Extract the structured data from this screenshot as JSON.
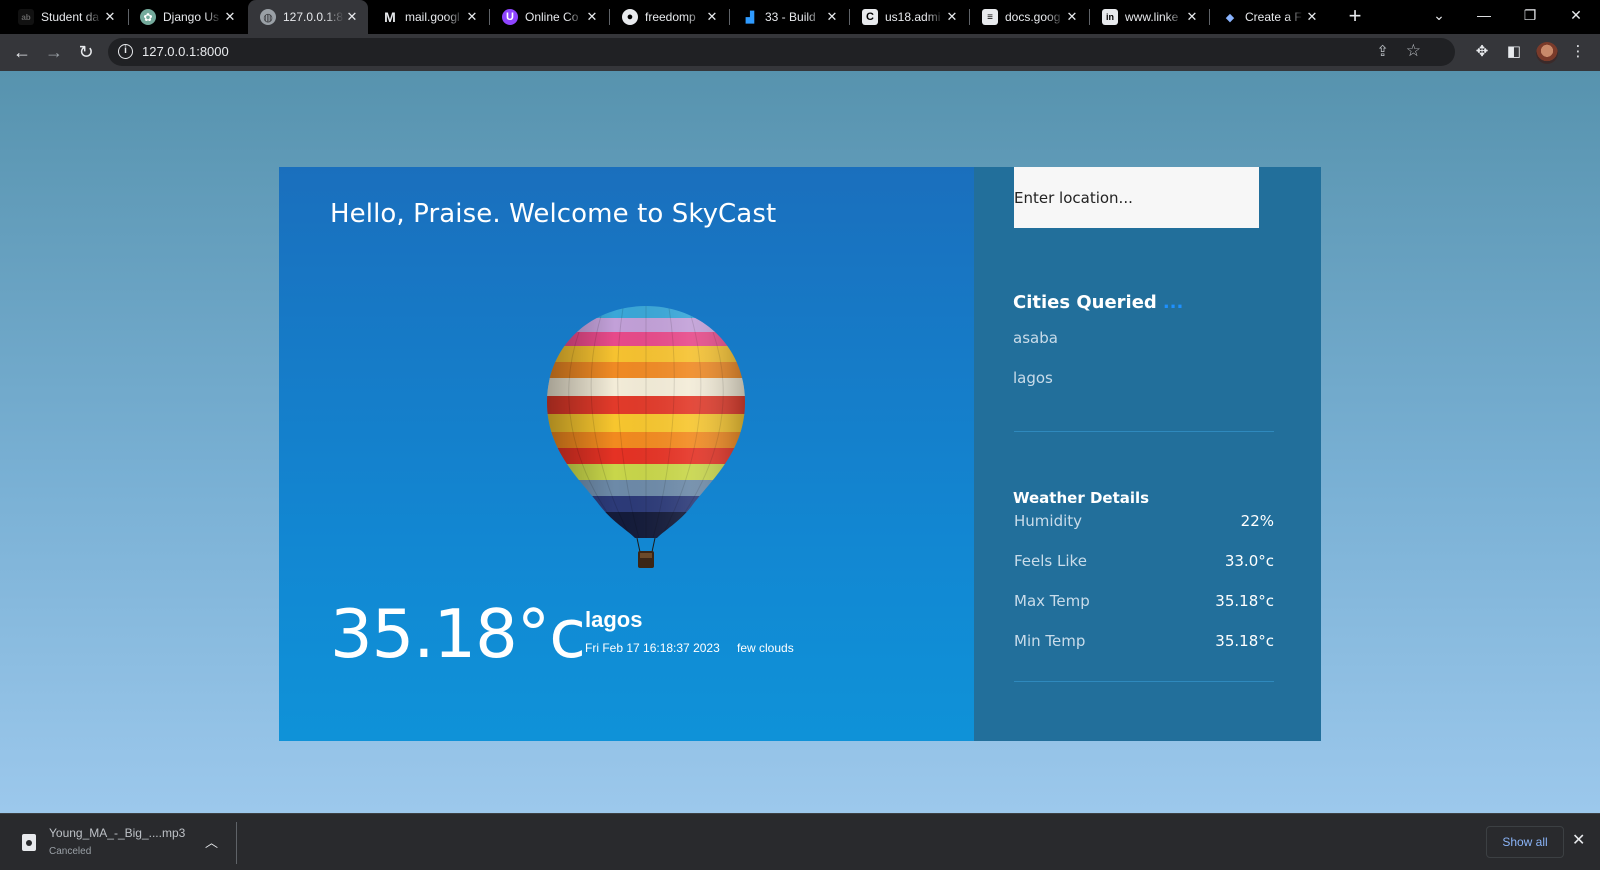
{
  "browser": {
    "tabs": [
      {
        "title": "Student da",
        "favicon": "dark-site-icon"
      },
      {
        "title": "Django Us",
        "favicon": "chatgpt-icon"
      },
      {
        "title": "127.0.0.1:8",
        "favicon": "globe-icon",
        "active": true
      },
      {
        "title": "mail.googl",
        "favicon": "gmail-icon"
      },
      {
        "title": "Online Co",
        "favicon": "purple-u-icon"
      },
      {
        "title": "freedomp",
        "favicon": "github-icon"
      },
      {
        "title": "33 - Build",
        "favicon": "azure-devops-icon"
      },
      {
        "title": "us18.admi",
        "favicon": "mailchimp-icon"
      },
      {
        "title": "docs.goog",
        "favicon": "docs-icon"
      },
      {
        "title": "www.linke",
        "favicon": "linkedin-icon"
      },
      {
        "title": "Create a F",
        "favicon": "diamond-icon"
      }
    ],
    "url": "127.0.0.1:8000"
  },
  "page": {
    "greeting": "Hello, Praise. Welcome to SkyCast",
    "temperature": "35.18°c",
    "city": "lagos",
    "datetime": "Fri Feb 17 16:18:37 2023",
    "description": "few clouds",
    "search_placeholder": "Enter location...",
    "cities_heading": "Cities Queried",
    "cities_dots": "...",
    "cities": [
      "asaba",
      "lagos"
    ],
    "details_heading": "Weather Details",
    "details": [
      {
        "label": "Humidity",
        "value": "22%"
      },
      {
        "label": "Feels Like",
        "value": "33.0°c"
      },
      {
        "label": "Max Temp",
        "value": "35.18°c"
      },
      {
        "label": "Min Temp",
        "value": "35.18°c"
      }
    ]
  },
  "downloads": {
    "file_name": "Young_MA_-_Big_....mp3",
    "status": "Canceled",
    "show_all_label": "Show all"
  },
  "colors": {
    "main_panel": "#1a6fbd",
    "side_panel": "#226f9b",
    "page_background": "#5793ae",
    "accent_dots": "#1e90ff"
  }
}
